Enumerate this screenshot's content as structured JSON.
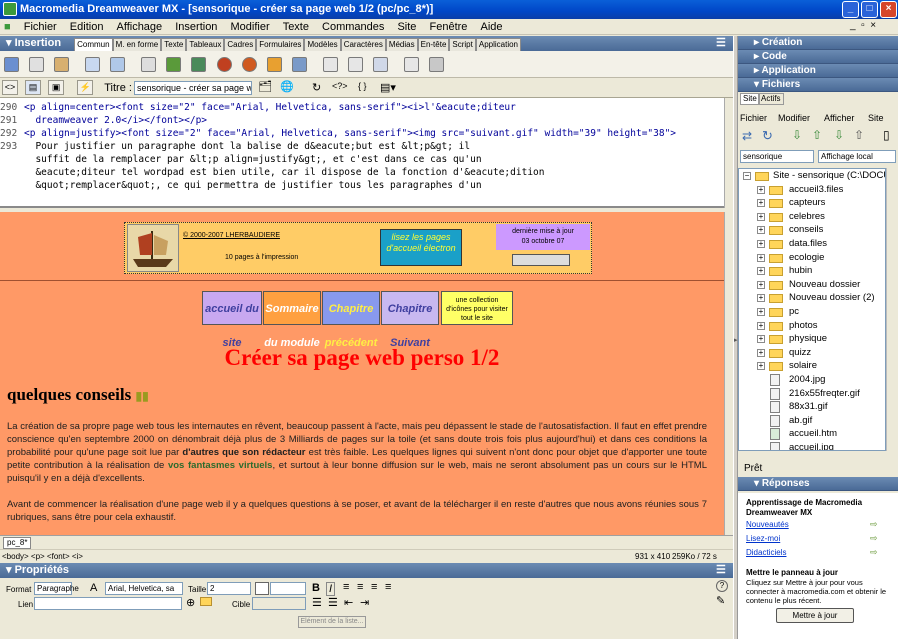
{
  "window": {
    "title": "Macromedia Dreamweaver MX - [sensorique - créer sa page web 1/2 (pc/pc_8*)]",
    "controls": [
      "_",
      "□",
      "×"
    ],
    "menu": [
      "Fichier",
      "Edition",
      "Affichage",
      "Insertion",
      "Modifier",
      "Texte",
      "Commandes",
      "Site",
      "Fenêtre",
      "Aide"
    ]
  },
  "insert_panel": {
    "title": "Insertion",
    "tabs": [
      "Commun",
      "M. en forme",
      "Texte",
      "Tableaux",
      "Cadres",
      "Formulaires",
      "Modèles",
      "Caractères",
      "Médias",
      "En-tête",
      "Script",
      "Application"
    ],
    "selected_tab": "Commun"
  },
  "doc_toolbar": {
    "title_label": "Titre :",
    "title_value": "sensorique - créer sa page we"
  },
  "code": [
    {
      "ln": "290",
      "text": "<p align=center><font size=\"2\" face=\"Arial, Helvetica, sans-serif\"><i>l'&eacute;diteur"
    },
    {
      "ln": "291",
      "text": "  dreamweaver 2.0</i></font></p>"
    },
    {
      "ln": "292",
      "text": "<p align=justify><font size=\"2\" face=\"Arial, Helvetica, sans-serif\"><img src=\"suivant.gif\" width=\"39\" height=\"38\">"
    },
    {
      "ln": "293",
      "text": "  Pour justifier un paragraphe dont la balise de d&eacute;but est &lt;p&gt; il"
    },
    {
      "ln": "",
      "text": "  suffit de la remplacer par &lt;p align=justify&gt;, et c'est dans ce cas qu'un"
    },
    {
      "ln": "",
      "text": "  &eacute;diteur tel wordpad est bien utile, car il dispose de la fonction d'&eacute;dition"
    },
    {
      "ln": "",
      "text": "  &quot;remplacer&quot;, ce qui permettra de justifier tous les paragraphes d'un"
    }
  ],
  "page": {
    "header": {
      "copyright": "© 2000-2007 LHERBAUDIERE",
      "pages_note": "10 pages à l'impression",
      "banner": "lisez les pages d'accueil électron",
      "update_label": "dernière mise à jour",
      "update_date": "03 octobre 07"
    },
    "nav": {
      "b1": "accueil du site",
      "b2": "Sommaire du module",
      "b3": "Chapitre précédent",
      "b4": "Chapitre Suivant",
      "b5": "une collection d'icônes pour visiter tout le site"
    },
    "title": "Créer sa page web perso 1/2",
    "section": "quelques conseils",
    "p1_a": "La création de sa propre page web tous les internautes en rêvent, beaucoup passent à l'acte, mais peu dépassent le stade de l'autosatisfaction. Il faut en effet prendre conscience qu'en septembre 2000 on dénombrait déjà plus de 3 Milliards de pages sur la toile (et sans doute trois fois plus aujourd'hui) et dans ces conditions la probabilité pour qu'une page soit lue par ",
    "p1_b": "d'autres que son rédacteur",
    "p1_c": " est très faible. Les quelques lignes qui suivent n'ont donc pour objet que d'apporter une toute petite contribution à la réalisation de ",
    "p1_d": "vos fantasmes virtuels",
    "p1_e": ", et surtout à leur bonne diffusion sur le web, mais ne seront absolument pas un cours sur le HTML puisqu'il y en a déjà d'excellents.",
    "p2": "Avant de commencer la réalisation d'une page web il y a quelques questions à se poser, et avant de la télécharger il en reste d'autres que nous avons réunies sous 7 rubriques, sans être pour cela exhaustif."
  },
  "doc_tab": "pc_8*",
  "status": {
    "tags": "<body> <p> <font> <i>",
    "size": "931 x 410",
    "weight": "259Ko / 72 s"
  },
  "properties": {
    "title": "Propriétés",
    "format_label": "Format",
    "format_value": "Paragraphe",
    "font_value": "Arial, Helvetica, sa",
    "size_label": "Taille",
    "size_value": "2",
    "link_label": "Lien",
    "target_label": "Cible",
    "list_item_btn": "Elément de la liste..."
  },
  "right_panels": {
    "creation": "Création",
    "code": "Code",
    "application": "Application",
    "fichiers": "Fichiers",
    "site_tabs": [
      "Site",
      "Actifs"
    ],
    "file_menu": [
      "Fichier",
      "Modifier",
      "Afficher",
      "Site"
    ],
    "site_select": "sensorique",
    "view_select": "Affichage local",
    "root": "Site - sensorique (C:\\DOCUME",
    "folders": [
      "accueil3.files",
      "capteurs",
      "celebres",
      "conseils",
      "data.files",
      "ecologie",
      "hubin",
      "Nouveau dossier",
      "Nouveau dossier (2)",
      "pc",
      "photos",
      "physique",
      "quizz",
      "solaire"
    ],
    "files": [
      "2004.jpg",
      "216x55freqter.gif",
      "88x31.gif",
      "ab.gif",
      "accueil.htm",
      "accueil.jpg"
    ],
    "ready": "Prêt",
    "reponses": "Réponses",
    "rep_title": "Apprentissage de Macromedia Dreamweaver MX",
    "rep_links": [
      "Nouveautés",
      "Lisez-moi",
      "Didacticiels"
    ],
    "update_title": "Mettre le panneau à jour",
    "update_text": "Cliquez sur Mettre à jour pour vous connecter à macromedia.com et obtenir le contenu le plus récent.",
    "update_btn": "Mettre à jour"
  }
}
